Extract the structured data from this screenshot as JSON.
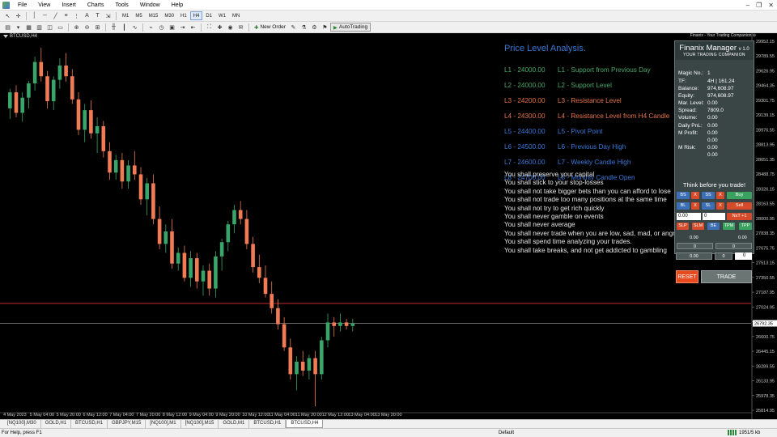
{
  "menu": {
    "items": [
      "File",
      "View",
      "Insert",
      "Charts",
      "Tools",
      "Window",
      "Help"
    ],
    "window_controls": [
      "–",
      "❐",
      "✕"
    ]
  },
  "toolbar": {
    "timeframes": [
      "M1",
      "M5",
      "M15",
      "M30",
      "H1",
      "H4",
      "D1",
      "W1",
      "MN"
    ],
    "active_timeframe": "H4",
    "new_order_label": "New Order",
    "autotrading_label": "AutoTrading"
  },
  "chart": {
    "symbol_title": "BTCUSD,H4",
    "price_labels": [
      "29952.15",
      "29789.55",
      "29626.95",
      "29464.35",
      "29301.75",
      "29139.15",
      "28976.55",
      "28813.95",
      "28651.35",
      "28488.75",
      "28326.15",
      "28163.55",
      "28000.95",
      "27838.35",
      "27675.75",
      "27513.15",
      "27350.55",
      "27187.95",
      "27025.35",
      "26862.75",
      "26700.15",
      "26537.55",
      "26374.95",
      "26212.35",
      "26049.75",
      "25887.15"
    ],
    "price_labels_shown": [
      "29952.15",
      "29789.55",
      "29626.95",
      "29464.35",
      "29301.75",
      "29139.15",
      "28976.55",
      "28813.95",
      "28651.35",
      "28488.75",
      "28326.15",
      "28163.55",
      "28000.95",
      "27838.35",
      "27675.75",
      "27513.15",
      "27350.55",
      "27187.95",
      "27024.95",
      "26792.35",
      "26600.75",
      "26445.15",
      "26289.55",
      "26133.95",
      "25978.35",
      "25814.95"
    ],
    "current_price_label": "26792.35",
    "red_line_label": "",
    "time_labels": [
      "4 May 2023",
      "5 May 04:00",
      "5 May 20:00",
      "6 May 12:00",
      "7 May 04:00",
      "7 May 20:00",
      "8 May 12:00",
      "9 May 04:00",
      "9 May 20:00",
      "10 May 12:00",
      "11 May 04:00",
      "11 May 20:00",
      "12 May 12:00",
      "13 May 04:00",
      "13 May 20:00"
    ],
    "colors": {
      "bull": "#3aa56a",
      "bear": "#f07b55",
      "background": "#000000",
      "current_line": "#b0b0b0",
      "red_line": "#ff3b3b"
    },
    "candles": [
      [
        29200,
        29420,
        29080,
        29380
      ],
      [
        29380,
        29460,
        29100,
        29150
      ],
      [
        29150,
        29380,
        29050,
        29320
      ],
      [
        29320,
        29510,
        29200,
        29480
      ],
      [
        29480,
        29780,
        29400,
        29720
      ],
      [
        29720,
        29880,
        29500,
        29560
      ],
      [
        29560,
        29620,
        29200,
        29280
      ],
      [
        29280,
        29560,
        29180,
        29520
      ],
      [
        29520,
        29760,
        29420,
        29680
      ],
      [
        29680,
        29820,
        29500,
        29560
      ],
      [
        29560,
        29640,
        29250,
        29300
      ],
      [
        29300,
        29380,
        28900,
        28960
      ],
      [
        28960,
        29250,
        28820,
        29180
      ],
      [
        29180,
        29290,
        28860,
        28920
      ],
      [
        28920,
        29100,
        28700,
        29000
      ],
      [
        29000,
        29060,
        28650,
        28720
      ],
      [
        28720,
        28820,
        28400,
        28480
      ],
      [
        28480,
        28680,
        28400,
        28620
      ],
      [
        28620,
        28700,
        28300,
        28380
      ],
      [
        28380,
        28620,
        28300,
        28560
      ],
      [
        28560,
        28720,
        28400,
        28460
      ],
      [
        28460,
        28540,
        28120,
        28180
      ],
      [
        28180,
        28420,
        28000,
        28360
      ],
      [
        28360,
        28460,
        27900,
        27960
      ],
      [
        27960,
        28100,
        27620,
        27680
      ],
      [
        27680,
        27900,
        27580,
        27820
      ],
      [
        27820,
        27960,
        27400,
        27460
      ],
      [
        27460,
        27640,
        27380,
        27580
      ],
      [
        27580,
        27660,
        27260,
        27300
      ],
      [
        27300,
        27600,
        27200,
        27520
      ],
      [
        27520,
        27580,
        27180,
        27260
      ],
      [
        27260,
        27440,
        27100,
        27380
      ],
      [
        27380,
        27460,
        27100,
        27180
      ],
      [
        27180,
        27600,
        27080,
        27540
      ],
      [
        27540,
        27740,
        27380,
        27700
      ],
      [
        27700,
        27940,
        27600,
        27900
      ],
      [
        27900,
        28120,
        27800,
        28060
      ],
      [
        28060,
        28160,
        27900,
        27960
      ],
      [
        27960,
        28060,
        27620,
        27680
      ],
      [
        27680,
        27760,
        27360,
        27420
      ],
      [
        27420,
        27560,
        27240,
        27300
      ],
      [
        27300,
        27440,
        27080,
        27120
      ],
      [
        27120,
        27260,
        26900,
        26960
      ],
      [
        26960,
        27060,
        26720,
        26780
      ],
      [
        26780,
        26860,
        26480,
        26520
      ],
      [
        26520,
        26620,
        26160,
        26220
      ],
      [
        26220,
        26420,
        26040,
        26360
      ],
      [
        26360,
        26480,
        26200,
        26260
      ],
      [
        26260,
        26440,
        26160,
        26400
      ],
      [
        26400,
        26480,
        25860,
        26220
      ],
      [
        26220,
        26640,
        26160,
        26600
      ],
      [
        26600,
        26900,
        26520,
        26800
      ],
      [
        26800,
        26860,
        26640,
        26760
      ],
      [
        26760,
        26900,
        26700,
        26800
      ],
      [
        26800,
        26840,
        26720,
        26760
      ],
      [
        26760,
        26840,
        26700,
        26790
      ]
    ]
  },
  "analysis": {
    "title": "Price Level Analysis.",
    "levels": [
      {
        "label": "L1 - 24000.00",
        "desc": "L1 - Support from Previous Day",
        "color": "#4aaa6a"
      },
      {
        "label": "L2 - 24000.00",
        "desc": "L2 - Support Level",
        "color": "#4aaa6a"
      },
      {
        "label": "L3 - 24200.00",
        "desc": "L3 - Resistance Level",
        "color": "#e8744a"
      },
      {
        "label": "L4 - 24300.00",
        "desc": "L4 - Resistance Level from H4 Candle",
        "color": "#e8744a"
      },
      {
        "label": "L5 - 24400.00",
        "desc": "L5 - Pivot Point",
        "color": "#3c78d8"
      },
      {
        "label": "L6 - 24500.00",
        "desc": "L6 - Previous Day High",
        "color": "#3c78d8"
      },
      {
        "label": "L7 - 24600.00",
        "desc": "L7 - Weekly Candle High",
        "color": "#3c78d8"
      },
      {
        "label": "L8 - 24700.00",
        "desc": "L8 - Monthly Candle Open",
        "color": "#3c78d8"
      }
    ],
    "rules": [
      "You shall preserve your capital",
      "You shall stick to your stop-losses",
      "You shall not take bigger bets than you can afford to lose",
      "You shall not trade too many positions at the same time",
      "You shall not try to get rich quickly",
      "You shall never gamble on events",
      "You shall never average",
      "You shall never trade when you are low, sad, mad, or angry",
      "You shall spend time analyzing your trades.",
      "You shall take breaks, and not get addicted to gambling"
    ]
  },
  "panel": {
    "header": "Finanix - Your Trading Companion",
    "title": "Finanix Manager",
    "version": "v 1.0",
    "subtitle": "YOUR TRADING COMPANION",
    "stats": [
      {
        "k": "Magic No.:",
        "v": "1"
      },
      {
        "k": "TF:",
        "v": "4H | 161.24"
      },
      {
        "k": "Balance:",
        "v": "974,608.97"
      },
      {
        "k": "Equity:",
        "v": "974,608.97"
      },
      {
        "k": "Mar. Level:",
        "v": "0.00"
      },
      {
        "k": "Spread:",
        "v": "7809.0"
      },
      {
        "k": "Volume:",
        "v": "0.00"
      },
      {
        "k": "Daily PnL:",
        "v": "0.00"
      },
      {
        "k": "M Profit:",
        "v": "0.00"
      },
      {
        "k": "",
        "v": "0.00"
      },
      {
        "k": "M Risk:",
        "v": "0.00"
      },
      {
        "k": "",
        "v": "0.00"
      }
    ],
    "slogan": "Think before you trade!",
    "row1": [
      "BS",
      "X",
      "SS",
      "X",
      "Buy"
    ],
    "row2": [
      "BL",
      "X",
      "SL",
      "X",
      "Sell"
    ],
    "field_a": "0.00",
    "field_b": "0",
    "nxt_label": "NxT +1",
    "row4": [
      "SLP",
      "SLM",
      "BE",
      "TPM",
      "TPP"
    ],
    "val_a": "0.00",
    "val_b": "0.00",
    "val_c": "0",
    "val_d": "0",
    "val_e": "0.00",
    "val_f": "0",
    "val_g": "0",
    "reset_label": "RESET",
    "trade_label": "TRADE"
  },
  "tabs": {
    "items": [
      "[NQ100],M30",
      "GOLD,H1",
      "BTCUSD,H1",
      "GBPJPY,M15",
      "[NQ100],M1",
      "[NQ100],M15",
      "GOLD,M1",
      "BTCUSD,H1",
      "BTCUSD,H4"
    ],
    "active_index": 8
  },
  "status": {
    "help": "For Help, press F1",
    "profile": "Default",
    "connection": "1951/5 kb"
  }
}
